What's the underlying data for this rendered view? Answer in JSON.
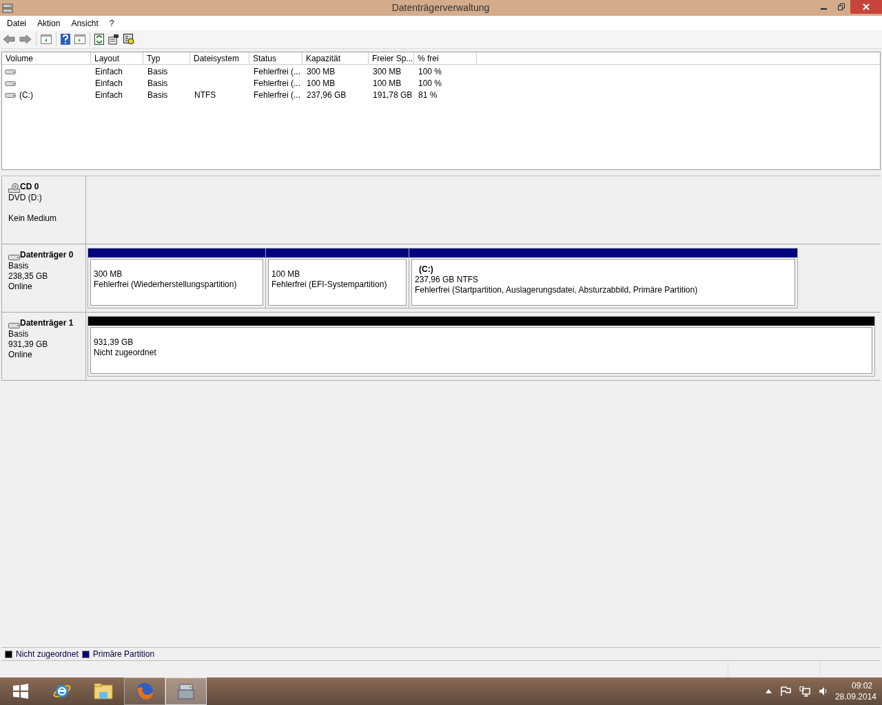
{
  "window": {
    "title": "Datenträgerverwaltung"
  },
  "menu": [
    "Datei",
    "Aktion",
    "Ansicht",
    "?"
  ],
  "table": {
    "columns": [
      "Volume",
      "Layout",
      "Typ",
      "Dateisystem",
      "Status",
      "Kapazität",
      "Freier Sp...",
      "% frei"
    ],
    "rows": [
      [
        "",
        "Einfach",
        "Basis",
        "",
        "Fehlerfrei (...",
        "300 MB",
        "300 MB",
        "100 %"
      ],
      [
        "",
        "Einfach",
        "Basis",
        "",
        "Fehlerfrei (...",
        "100 MB",
        "100 MB",
        "100 %"
      ],
      [
        "(C:)",
        "Einfach",
        "Basis",
        "NTFS",
        "Fehlerfrei (...",
        "237,96 GB",
        "191,78 GB",
        "81 %"
      ]
    ]
  },
  "disks": [
    {
      "kind": "cd",
      "name": "CD 0",
      "lines": [
        "DVD (D:)",
        "Kein Medium"
      ]
    },
    {
      "kind": "disk",
      "name": "Datenträger 0",
      "lines": [
        "Basis",
        "238,35 GB",
        "Online"
      ],
      "partitions": [
        {
          "color": "#000080",
          "lines": [
            "300 MB",
            "Fehlerfrei (Wiederherstellungspartition)"
          ]
        },
        {
          "color": "#000080",
          "lines": [
            "100 MB",
            "Fehlerfrei (EFI-Systempartition)"
          ]
        },
        {
          "color": "#000080",
          "label": "(C:)",
          "lines": [
            "237,96 GB NTFS",
            "Fehlerfrei (Startpartition, Auslagerungsdatei, Absturzabbild, Primäre Partition)"
          ]
        }
      ]
    },
    {
      "kind": "disk",
      "name": "Datenträger 1",
      "lines": [
        "Basis",
        "931,39 GB",
        "Online"
      ],
      "partitions": [
        {
          "color": "#000000",
          "lines": [
            "931,39 GB",
            "Nicht zugeordnet"
          ]
        }
      ]
    }
  ],
  "legend": [
    {
      "color": "#000000",
      "label": "Nicht zugeordnet"
    },
    {
      "color": "#000080",
      "label": "Primäre Partition"
    }
  ],
  "taskbar": {
    "apps": [
      {
        "kind": "start",
        "running": false,
        "selected": false
      },
      {
        "kind": "ie",
        "running": false,
        "selected": false
      },
      {
        "kind": "explorer",
        "running": false,
        "selected": false
      },
      {
        "kind": "firefox",
        "running": true,
        "selected": false
      },
      {
        "kind": "diskmgmt",
        "running": true,
        "selected": true
      }
    ],
    "time": "09:02",
    "date": "28.09.2014"
  }
}
